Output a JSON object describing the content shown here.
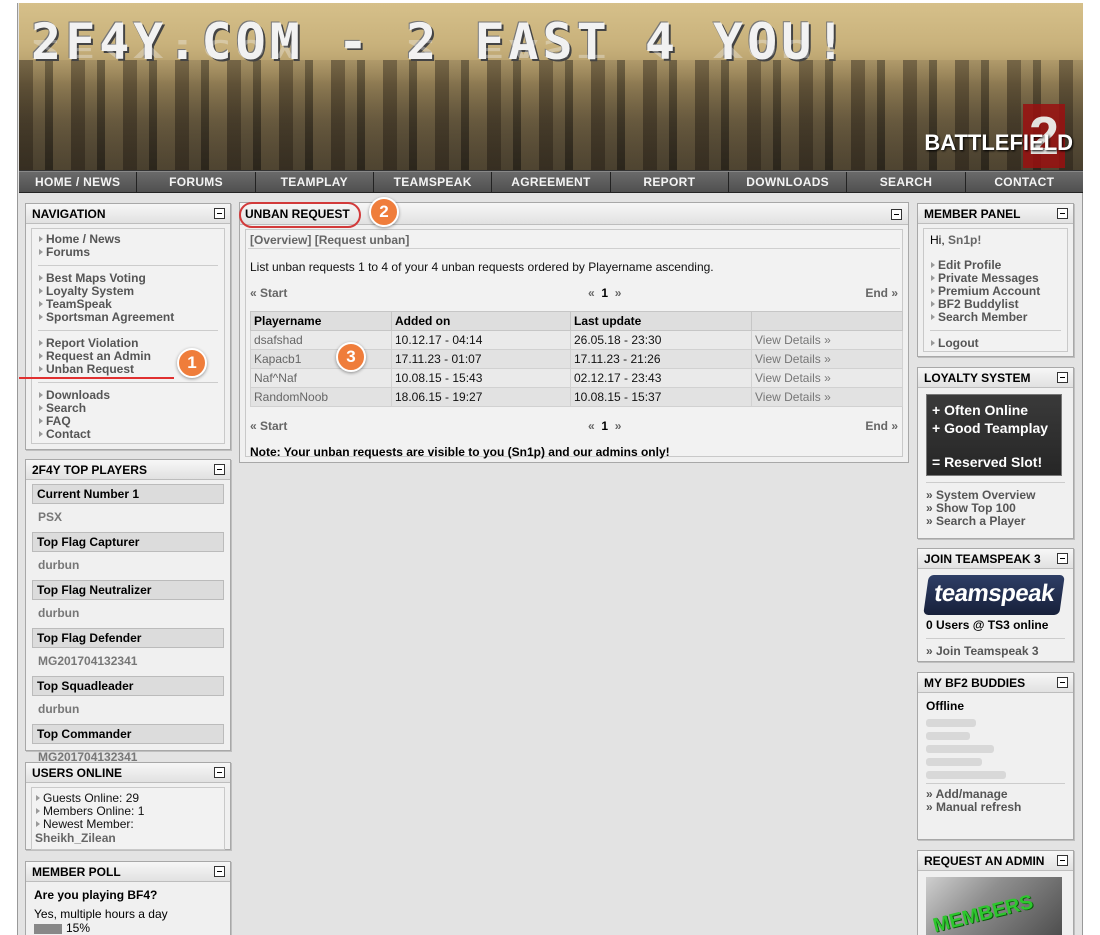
{
  "banner": {
    "title": "2F4Y.COM - 2 FAST 4 YOU!",
    "game_logo": "BATTLEFIELD",
    "game_number": "2"
  },
  "topnav": [
    "HOME / NEWS",
    "FORUMS",
    "TEAMPLAY",
    "TEAMSPEAK",
    "AGREEMENT",
    "REPORT",
    "DOWNLOADS",
    "SEARCH",
    "CONTACT"
  ],
  "navigation": {
    "title": "NAVIGATION",
    "group1": [
      "Home / News",
      "Forums"
    ],
    "group2": [
      "Best Maps Voting",
      "Loyalty System",
      "TeamSpeak",
      "Sportsman Agreement"
    ],
    "group3": [
      "Report Violation",
      "Request an Admin",
      "Unban Request"
    ],
    "group4": [
      "Downloads",
      "Search",
      "FAQ",
      "Contact"
    ]
  },
  "top_players": {
    "title": "2F4Y TOP PLAYERS",
    "categories": [
      {
        "label": "Current Number 1",
        "player": "PSX"
      },
      {
        "label": "Top Flag Capturer",
        "player": "durbun"
      },
      {
        "label": "Top Flag Neutralizer",
        "player": "durbun"
      },
      {
        "label": "Top Flag Defender",
        "player": "MG201704132341"
      },
      {
        "label": "Top Squadleader",
        "player": "durbun"
      },
      {
        "label": "Top Commander",
        "player": "MG201704132341"
      }
    ]
  },
  "users_online": {
    "title": "USERS ONLINE",
    "guests": "Guests Online: 29",
    "members": "Members Online: 1",
    "newest_label": "Newest Member:",
    "newest_member": "Sheikh_Zilean"
  },
  "member_poll": {
    "title": "MEMBER POLL",
    "question": "Are you playing BF4?",
    "option1": "Yes, multiple hours a day",
    "option1_pct": "15%"
  },
  "main": {
    "title": "UNBAN REQUEST",
    "tab_overview": "[Overview]",
    "tab_request": "[Request unban]",
    "list_info": "List unban requests 1 to 4 of your 4 unban requests ordered by Playername ascending.",
    "pager": {
      "start": "« Start",
      "prev": "«",
      "page": "1",
      "next": "»",
      "end": "End »"
    },
    "columns": [
      "Playername",
      "Added on",
      "Last update",
      ""
    ],
    "rows": [
      {
        "player": "dsafshad",
        "added": "10.12.17 - 04:14",
        "updated": "26.05.18 - 23:30",
        "action": "View Details »"
      },
      {
        "player": "Kapacb1",
        "added": "17.11.23 - 01:07",
        "updated": "17.11.23 - 21:26",
        "action": "View Details »"
      },
      {
        "player": "Naf^Naf",
        "added": "10.08.15 - 15:43",
        "updated": "02.12.17 - 23:43",
        "action": "View Details »"
      },
      {
        "player": "RandomNoob",
        "added": "18.06.15 - 19:27",
        "updated": "10.08.15 - 15:37",
        "action": "View Details »"
      }
    ],
    "note": "Note: Your unban requests are visible to you (Sn1p) and our admins only!"
  },
  "member_panel": {
    "title": "MEMBER PANEL",
    "greeting": "Hi,",
    "username": "Sn1p!",
    "links": [
      "Edit Profile",
      "Private Messages",
      "Premium Account",
      "BF2 Buddylist",
      "Search Member"
    ],
    "logout": "Logout"
  },
  "loyalty": {
    "title": "LOYALTY SYSTEM",
    "img_line1": "+ Often Online",
    "img_line2": "+ Good Teamplay",
    "img_line3": "= Reserved Slot!",
    "links": [
      "» System Overview",
      "» Show Top 100",
      "» Search a Player"
    ]
  },
  "teamspeak": {
    "title": "JOIN TEAMSPEAK 3",
    "logo": "teamspeak",
    "status": "0 Users @ TS3 online",
    "link": "» Join Teamspeak 3"
  },
  "buddies": {
    "title": "MY BF2 BUDDIES",
    "status": "Offline",
    "links": [
      "» Add/manage",
      "» Manual refresh"
    ]
  },
  "request_admin": {
    "title": "REQUEST AN ADMIN",
    "img_text": "MEMBERS"
  },
  "annotations": {
    "badge1": "1",
    "badge2": "2",
    "badge3": "3"
  },
  "colors": {
    "badge": "#ef7d3b",
    "highlight": "#d23a3a",
    "nav_bar": "#555555"
  }
}
